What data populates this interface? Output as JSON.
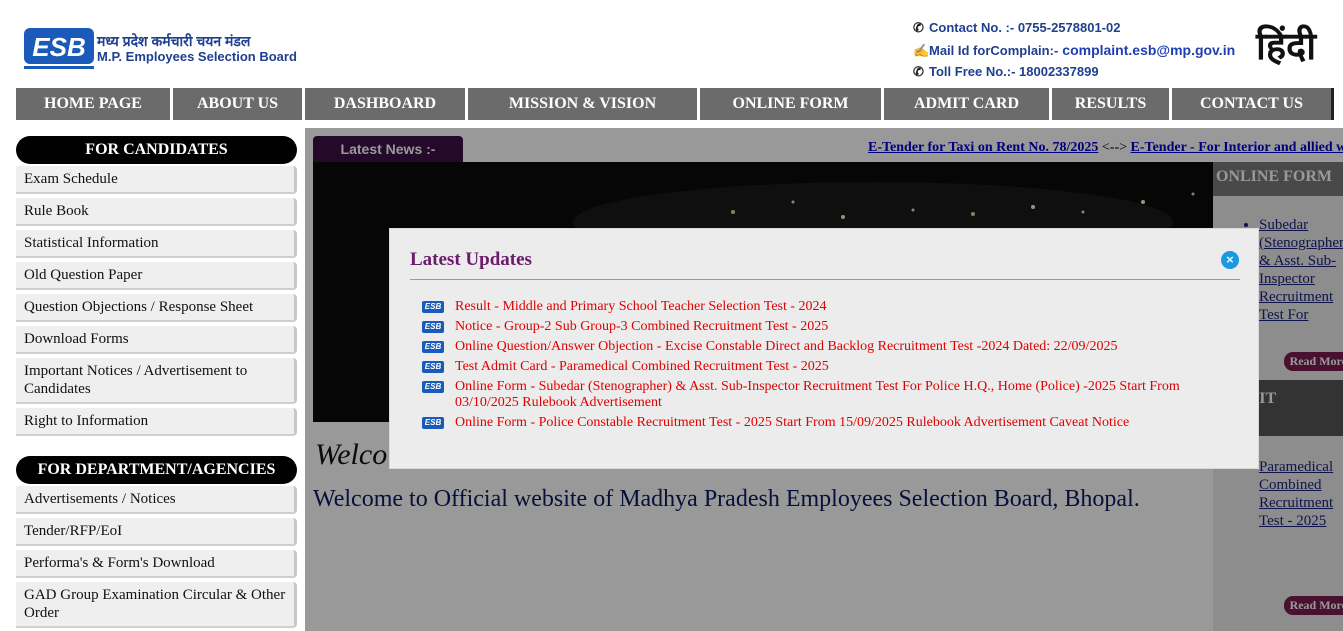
{
  "header": {
    "logo_text": "ESB",
    "org_hindi": "मध्य प्रदेश कर्मचारी चयन मंडल",
    "org_english": "M.P. Employees Selection Board",
    "contact": "Contact No. :- 0755-2578801-02",
    "mail_label": "Mail Id forComplain:-",
    "mail_value": "complaint.esb@mp.gov.in",
    "toll_free": "Toll Free No.:- 18002337899",
    "hindi_label": "हिंदी"
  },
  "nav": [
    {
      "label": "HOME PAGE",
      "name": "nav-home-page"
    },
    {
      "label": "ABOUT US",
      "name": "nav-about-us"
    },
    {
      "label": "DASHBOARD",
      "name": "nav-dashboard"
    },
    {
      "label": "MISSION & VISION",
      "name": "nav-mission-vision"
    },
    {
      "label": "ONLINE FORM",
      "name": "nav-online-form"
    },
    {
      "label": "ADMIT CARD",
      "name": "nav-admit-card"
    },
    {
      "label": "RESULTS",
      "name": "nav-results"
    },
    {
      "label": "CONTACT US",
      "name": "nav-contact-us"
    }
  ],
  "candidates": {
    "title": "FOR CANDIDATES",
    "items": [
      "Exam Schedule",
      "Rule Book",
      "Statistical Information",
      "Old Question Paper",
      "Question Objections / Response Sheet",
      "Download Forms",
      "Important Notices / Advertisement to Candidates",
      "Right to Information"
    ]
  },
  "department": {
    "title": "FOR DEPARTMENT/AGENCIES",
    "items": [
      "Advertisements / Notices",
      "Tender/RFP/EoI",
      "Performa's & Form's Download",
      "GAD Group Examination Circular & Other Order"
    ]
  },
  "main": {
    "news_label": "Latest News :-",
    "ticker_1": "E-Tender for Taxi on Rent No. 78/2025",
    "ticker_sep": "<-->",
    "ticker_2": "E-Tender - For Interior and allied w",
    "welcome_script": "Welco",
    "welcome": "Welcome to Official website of Madhya Pradesh Employees Selection Board, Bhopal."
  },
  "right_col": {
    "online_form_title": "ONLINE FORM",
    "online_form_item": "Subedar (Stenographer) & Asst. Sub-Inspector Recruitment Test For",
    "read_more": "Read More",
    "admit_title": "ADMIT",
    "admit_item": "Paramedical Combined Recruitment Test - 2025"
  },
  "modal": {
    "title": "Latest Updates",
    "close": "×",
    "updates": [
      "Result - Middle and Primary School Teacher Selection Test - 2024",
      "Notice - Group-2 Sub Group-3 Combined Recruitment Test - 2025",
      "Online Question/Answer Objection - Excise Constable Direct and Backlog Recruitment Test -2024   Dated: 22/09/2025",
      "Test Admit Card - Paramedical Combined Recruitment Test - 2025",
      "Online Form - Subedar (Stenographer) & Asst. Sub-Inspector  Recruitment Test For Police H.Q., Home (Police) -2025 Start From 03/10/2025  Rulebook   Advertisement",
      "Online Form - Police Constable Recruitment Test - 2025 Start From 15/09/2025  Rulebook  Advertisement   Caveat Notice"
    ]
  },
  "colors": {
    "nav_bg": "#6b6b6b",
    "brand_blue": "#1f3f8f",
    "modal_title": "#6a1b6a",
    "update_red": "#e00000"
  }
}
